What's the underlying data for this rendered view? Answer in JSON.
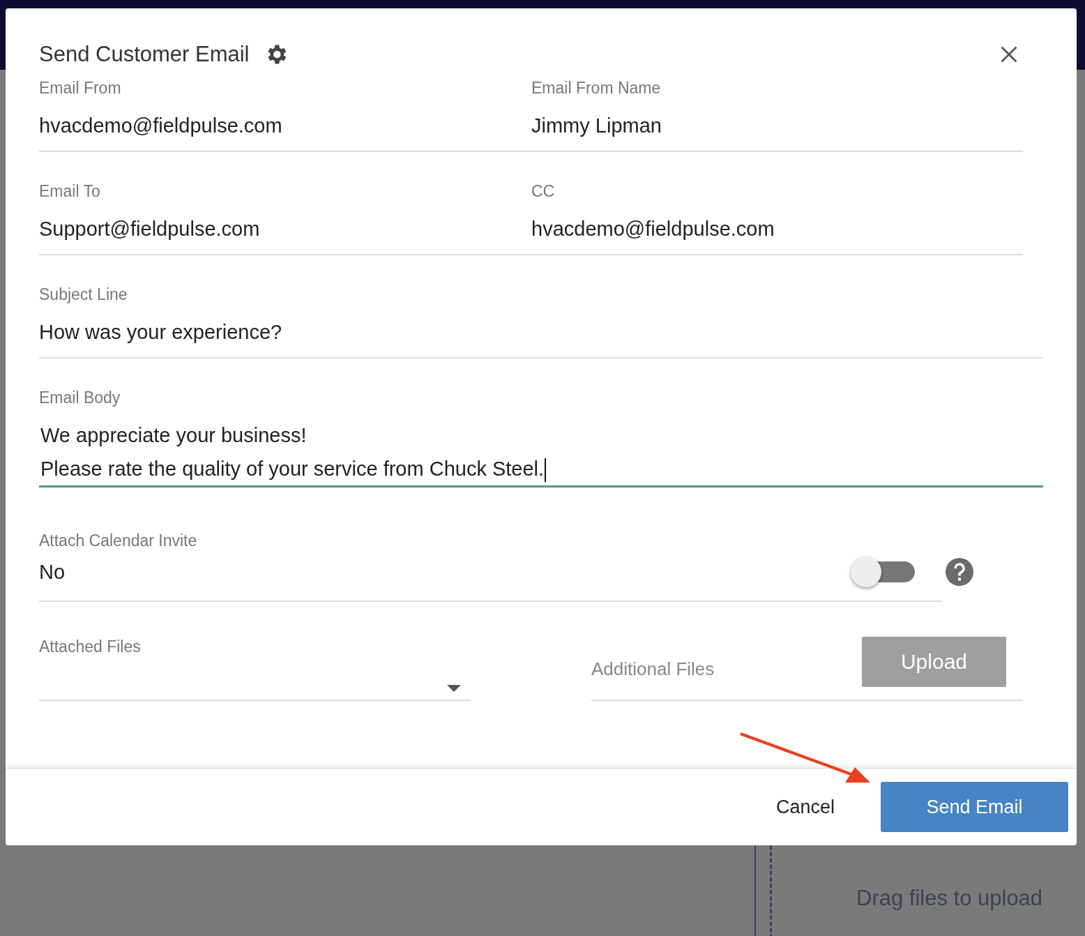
{
  "background": {
    "dropzone_text": "Drag files to upload"
  },
  "dialog": {
    "title": "Send Customer Email",
    "rows": [
      [
        {
          "label": "Email From",
          "value": "hvacdemo@fieldpulse.com"
        },
        {
          "label": "Email From Name",
          "value": "Jimmy Lipman"
        }
      ],
      [
        {
          "label": "Email To",
          "value": "Support@fieldpulse.com"
        },
        {
          "label": "CC",
          "value": "hvacdemo@fieldpulse.com"
        }
      ]
    ],
    "subject": {
      "label": "Subject Line",
      "value": "How was your experience?"
    },
    "body": {
      "label": "Email Body",
      "lines": [
        "We appreciate your business!",
        "Please rate the quality of your service from Chuck Steel."
      ],
      "focused": true
    },
    "calendar": {
      "label": "Attach Calendar Invite",
      "value": "No",
      "on": false
    },
    "attached_files": {
      "label": "Attached Files"
    },
    "additional_files": {
      "placeholder": "Additional Files",
      "button": "Upload",
      "disabled": true
    },
    "buttons": [
      {
        "kind": "text",
        "label": "Cancel"
      },
      {
        "kind": "primary",
        "label": "Send Email"
      }
    ]
  }
}
